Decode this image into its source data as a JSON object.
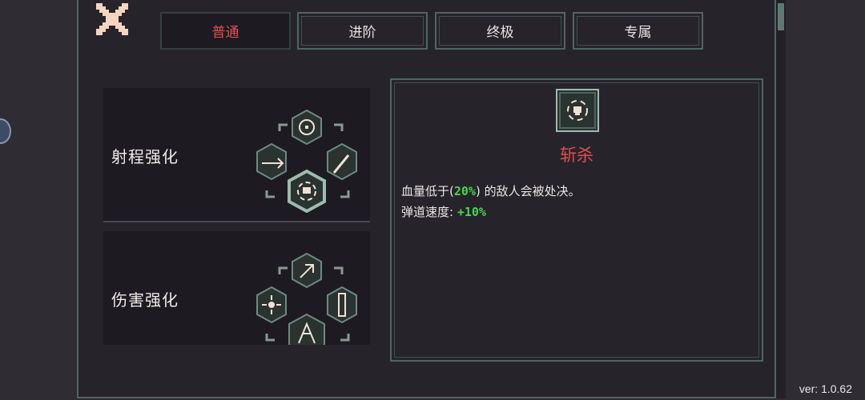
{
  "tabs": [
    {
      "label": "普通",
      "active": true
    },
    {
      "label": "进阶",
      "active": false
    },
    {
      "label": "终极",
      "active": false
    },
    {
      "label": "专属",
      "active": false
    }
  ],
  "skills": [
    {
      "name": "射程强化"
    },
    {
      "name": "伤害强化"
    }
  ],
  "detail": {
    "title": "斩杀",
    "line1_prefix": "血量低于",
    "line1_open": "(",
    "line1_value": "20%",
    "line1_close": ")",
    "line1_suffix": "的敌人会被处决。",
    "line2_label": "弹道速度:",
    "line2_value": "+10%"
  },
  "version": "ver: 1.0.62",
  "colors": {
    "accent_red": "#e0504f",
    "value_green": "#46d84a",
    "frame_teal": "#4f6660",
    "close_icon": "#f5d5c0"
  },
  "icons": {
    "close": "close-x-icon",
    "range_set": [
      "crosshair-icon",
      "bow-icon",
      "dagger-icon",
      "skull-target-icon"
    ],
    "damage_set": [
      "arrow-up-icon",
      "burst-icon",
      "bullet-icon",
      "spider-icon"
    ]
  }
}
